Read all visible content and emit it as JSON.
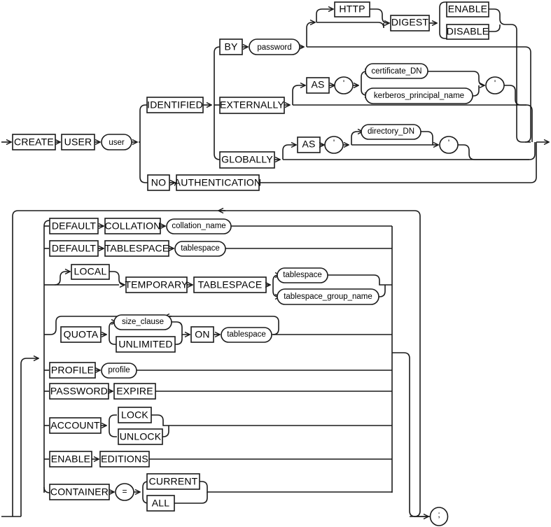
{
  "diagram": {
    "kind": "railroad-syntax-diagram",
    "title": "CREATE USER",
    "line_color": "#1a1a1a",
    "background": "#ffffff",
    "terminator": ";"
  },
  "keywords": {
    "create": "CREATE",
    "user": "USER",
    "identified": "IDENTIFIED",
    "by": "BY",
    "http": "HTTP",
    "digest": "DIGEST",
    "enable_http": "ENABLE",
    "disable_http": "DISABLE",
    "externally": "EXTERNALLY",
    "globally": "GLOBALLY",
    "as_ext": "AS",
    "as_glob": "AS",
    "no": "NO",
    "authentication": "AUTHENTICATION",
    "default_collation": "DEFAULT",
    "collation": "COLLATION",
    "default_tablespace": "DEFAULT",
    "tablespace_kw": "TABLESPACE",
    "local": "LOCAL",
    "temporary": "TEMPORARY",
    "tablespace_kw2": "TABLESPACE",
    "quota": "QUOTA",
    "unlimited": "UNLIMITED",
    "on": "ON",
    "profile": "PROFILE",
    "password": "PASSWORD",
    "expire": "EXPIRE",
    "account": "ACCOUNT",
    "lock": "LOCK",
    "unlock": "UNLOCK",
    "enable": "ENABLE",
    "editions": "EDITIONS",
    "container": "CONTAINER",
    "current": "CURRENT",
    "all": "ALL"
  },
  "nonterminals": {
    "user": "user",
    "password": "password",
    "certificate_dn": "certificate_DN",
    "kerberos_principal_name": "kerberos_principal_name",
    "directory_dn": "directory_DN",
    "collation_name": "collation_name",
    "tablespace1": "tablespace",
    "tablespace2": "tablespace",
    "tablespace_group_name": "tablespace_group_name",
    "size_clause": "size_clause",
    "tablespace3": "tablespace",
    "profile": "profile"
  },
  "punctuation": {
    "quote_open_ext": "'",
    "quote_close_ext": "'",
    "quote_open_glob": "'",
    "quote_close_glob": "'",
    "equals": "=",
    "semicolon": ";"
  }
}
